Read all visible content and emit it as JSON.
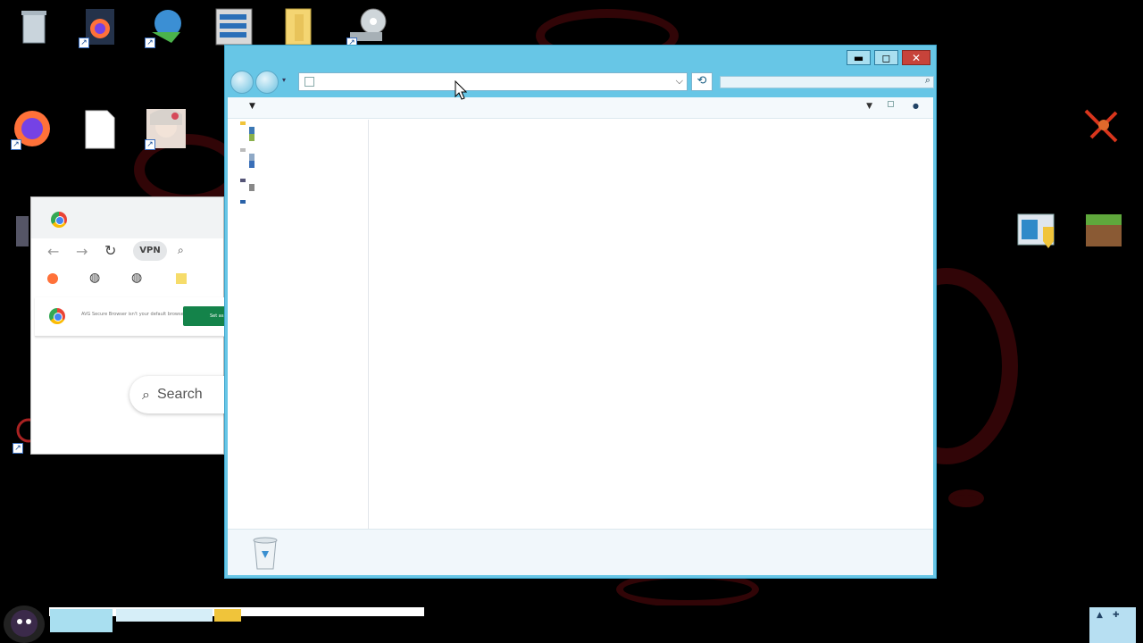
{
  "desktop": {
    "icons": [
      {
        "name": "recycle-bin",
        "icon": "recycle-bin-icon"
      },
      {
        "name": "firefox-doc",
        "icon": "firefox-icon"
      },
      {
        "name": "internet-download",
        "icon": "globe-download-icon"
      },
      {
        "name": "server-tool",
        "icon": "server-icon"
      },
      {
        "name": "folder",
        "icon": "folder-icon"
      },
      {
        "name": "disc-drive",
        "icon": "disc-icon"
      },
      {
        "name": "firefox",
        "icon": "firefox-icon"
      },
      {
        "name": "blank-file",
        "icon": "file-icon"
      },
      {
        "name": "anime-avatar",
        "icon": "avatar-icon"
      },
      {
        "name": "red-figure",
        "icon": "red-figure-icon"
      },
      {
        "name": "control-panel",
        "icon": "shield-window-icon"
      },
      {
        "name": "minecraft",
        "icon": "grass-block-icon"
      }
    ]
  },
  "explorer": {
    "title_buttons": {
      "minimize": "▬",
      "maximize": "◻",
      "close": "✕"
    },
    "address_dropdown": "⌵",
    "refresh": "⟲",
    "search_icon": "⌕",
    "organize_arrow": "▼",
    "views_arrow": "▼",
    "help": "●"
  },
  "browser": {
    "vpn": "VPN",
    "search_placeholder": "Search",
    "banner_text": "AVG Secure Browser isn't your default browser",
    "banner_button": "Set as"
  },
  "colors": {
    "explorer_frame": "#67c6e6",
    "close_button": "#c7433a",
    "banner_button": "#14834a"
  }
}
